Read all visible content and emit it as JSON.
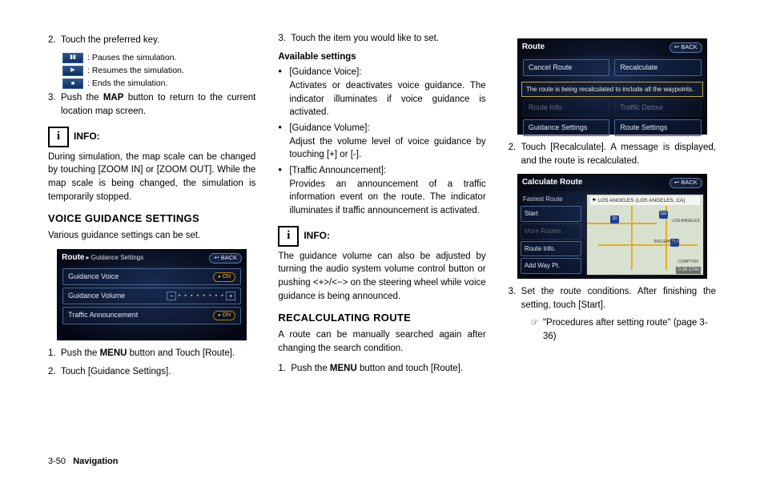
{
  "col1": {
    "step2": "Touch the preferred key.",
    "pause": "Pauses the simulation.",
    "resume": "Resumes the simulation.",
    "end": "Ends the simulation.",
    "step3_a": "Push the ",
    "step3_b": "MAP",
    "step3_c": " button to return to the current location map screen.",
    "info_label": "INFO:",
    "info_body": "During simulation, the map scale can be changed by touching [ZOOM IN] or [ZOOM OUT]. While the map scale is being changed, the simulation is temporarily stopped.",
    "voice_h": "VOICE GUIDANCE SETTINGS",
    "voice_sub": "Various guidance settings can be set.",
    "screen1": {
      "title": "Route",
      "crumb": "▸ Guidance Settings",
      "back": "↩ BACK",
      "r1": "Guidance Voice",
      "r1v": "ON",
      "r2": "Guidance Volume",
      "r3": "Traffic Announcement",
      "r3v": "ON"
    },
    "v_step1_a": "Push the ",
    "v_step1_b": "MENU",
    "v_step1_c": " button and Touch [Route].",
    "v_step2": "Touch [Guidance Settings]."
  },
  "col2": {
    "step3": "Touch the item you would like to set.",
    "avail": "Available settings",
    "b1_t": "[Guidance Voice]:",
    "b1_d": "Activates or deactivates voice guidance. The indicator illuminates if voice guidance is activated.",
    "b2_t": "[Guidance Volume]:",
    "b2_d": "Adjust the volume level of voice guidance by touching [+] or [-].",
    "b3_t": "[Traffic Announcement]:",
    "b3_d": "Provides an announcement of a traffic information event on the route. The indicator illuminates if traffic announcement is activated.",
    "info_label": "INFO:",
    "info_body": "The guidance volume can also be adjusted by turning the audio system volume control button or pushing <+>/<−> on the steering wheel while voice guidance is being announced.",
    "recalc_h": "RECALCULATING ROUTE",
    "recalc_sub": "A route can be manually searched again after changing the search condition.",
    "r_step1_a": "Push the ",
    "r_step1_b": "MENU",
    "r_step1_c": " button and touch [Route]."
  },
  "col3": {
    "screen2": {
      "title": "Route",
      "back": "↩ BACK",
      "cancel": "Cancel Route",
      "recalc": "Recalculate",
      "msg": "The route is being recalculated to include all the waypoints.",
      "gs": "Guidance Settings",
      "rs": "Route Settings",
      "ri": "Route Info.",
      "td": "Traffic Detour"
    },
    "step2": "Touch [Recalculate]. A message is displayed, and the route is recalculated.",
    "screen3": {
      "title": "Calculate Route",
      "back": "↩ BACK",
      "hdr": "Fastest Route",
      "dest": "⚑ LOS ANGELES (LOS ANGELES, CA)",
      "start": "Start",
      "more": "More Routes",
      "info": "Route Info.",
      "add": "Add Way Pt.",
      "c1": "LOS ANGELES",
      "c2": "INGLEWOOD",
      "c3": "COMPTON",
      "scale": "0:28   17mi"
    },
    "step3": "Set the route conditions. After finishing the setting, touch [Start].",
    "ref": "\"Procedures after setting route\" (page 3-36)"
  },
  "footer_page": "3-50",
  "footer_section": "Navigation"
}
